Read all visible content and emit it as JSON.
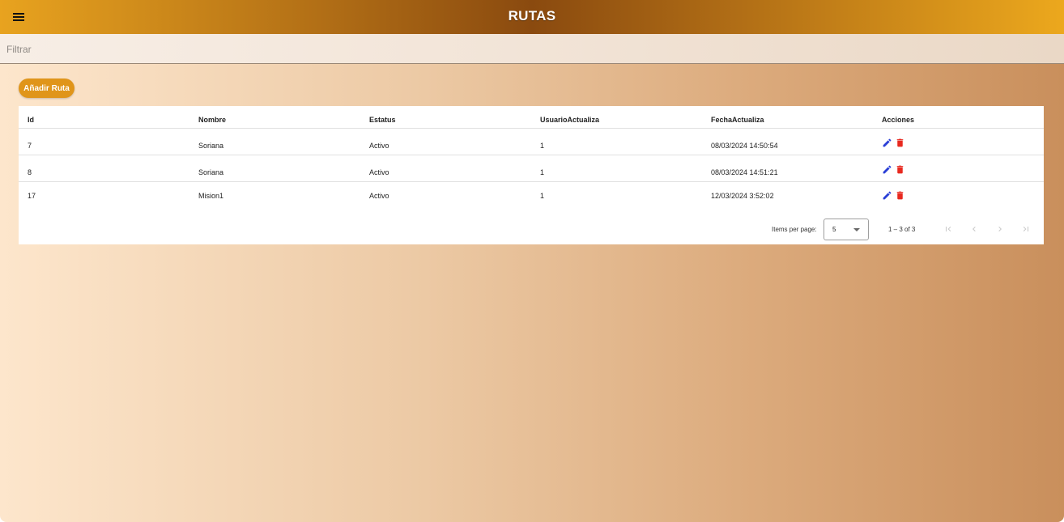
{
  "header": {
    "title": "RUTAS",
    "menu_icon": "menu-icon"
  },
  "filter": {
    "placeholder": "Filtrar",
    "value": ""
  },
  "add_button": {
    "label": "Añadir Ruta"
  },
  "table": {
    "columns": [
      "Id",
      "Nombre",
      "Estatus",
      "UsuarioActualiza",
      "FechaActualiza",
      "Acciones"
    ],
    "rows": [
      {
        "id": "7",
        "nombre": "Soriana",
        "estatus": "Activo",
        "usuario": "1",
        "fecha": "08/03/2024 14:50:54"
      },
      {
        "id": "8",
        "nombre": "Soriana",
        "estatus": "Activo",
        "usuario": "1",
        "fecha": "08/03/2024 14:51:21"
      },
      {
        "id": "17",
        "nombre": "Mision1",
        "estatus": "Activo",
        "usuario": "1",
        "fecha": "12/03/2024 3:52:02"
      }
    ],
    "action_icons": [
      "edit-icon",
      "delete-icon"
    ]
  },
  "paginator": {
    "items_per_page_label": "Items per page:",
    "page_size": "5",
    "range_label": "1 – 3 of 3"
  },
  "colors": {
    "accent": "#e0951a",
    "edit": "#2a3fd6",
    "delete": "#e8291f"
  }
}
